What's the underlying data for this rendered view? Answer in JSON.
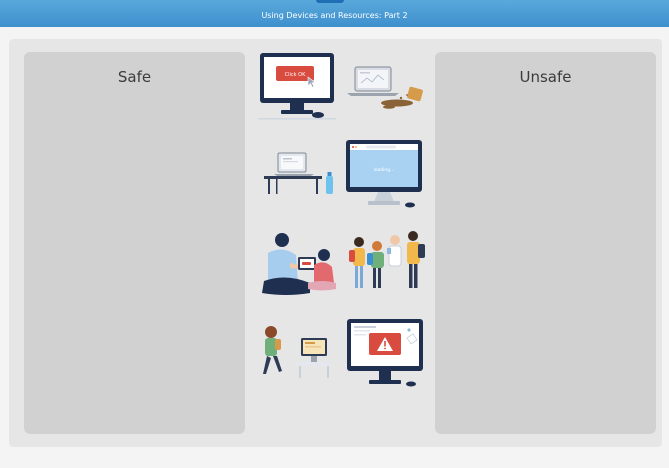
{
  "header": {
    "title": "Using Devices and Resources: Part 2"
  },
  "zones": {
    "safe": {
      "label": "Safe"
    },
    "unsafe": {
      "label": "Unsafe"
    }
  },
  "cards": {
    "popup_ad": {
      "button_text": "Click OK"
    },
    "loading_screen": {
      "status_text": "loading..."
    }
  },
  "colors": {
    "header": "#3d8fcd",
    "board": "#e6e6e6",
    "zone": "#d1d1d1",
    "monitor_frame": "#1f2f4f",
    "warning_red": "#d94a3f"
  }
}
